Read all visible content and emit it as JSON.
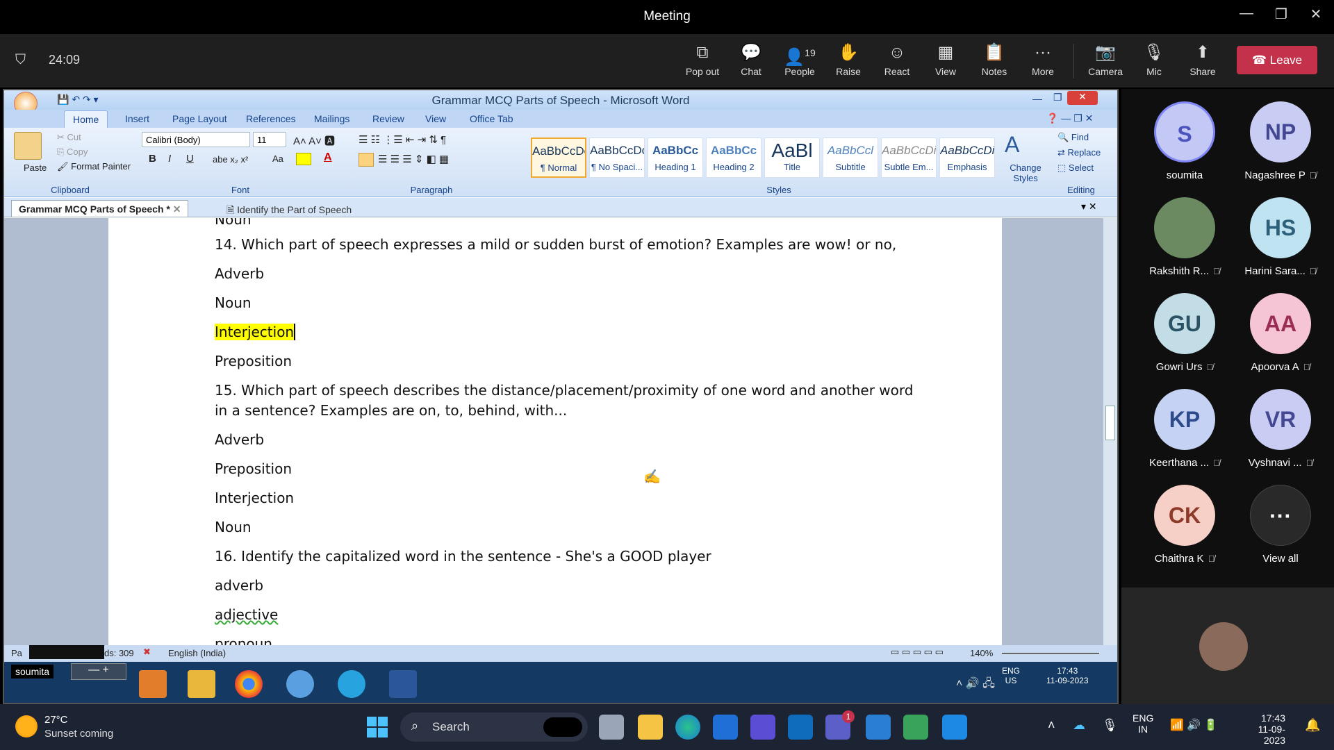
{
  "teams": {
    "window_title": "Meeting",
    "timer": "24:09",
    "toolbar": [
      {
        "label": "Pop out",
        "icon": "pop-out-icon"
      },
      {
        "label": "Chat",
        "icon": "chat-icon"
      },
      {
        "label": "People",
        "icon": "people-icon",
        "count": "19"
      },
      {
        "label": "Raise",
        "icon": "raise-hand-icon"
      },
      {
        "label": "React",
        "icon": "react-icon"
      },
      {
        "label": "View",
        "icon": "view-icon"
      },
      {
        "label": "Notes",
        "icon": "notes-icon"
      },
      {
        "label": "More",
        "icon": "more-icon"
      },
      {
        "label": "Camera",
        "icon": "camera-off-icon"
      },
      {
        "label": "Mic",
        "icon": "mic-off-icon"
      },
      {
        "label": "Share",
        "icon": "share-icon"
      }
    ],
    "leave_label": "Leave",
    "participants": [
      {
        "initials": "S",
        "name": "soumita",
        "bg": "#c3c8f5",
        "fg": "#4b53bc"
      },
      {
        "initials": "NP",
        "name": "Nagashree P",
        "bg": "#c9cdf3",
        "fg": "#444791"
      },
      {
        "initials": "",
        "name": "Rakshith R...",
        "bg": "#6b8a62",
        "fg": "#fff"
      },
      {
        "initials": "HS",
        "name": "Harini Sara...",
        "bg": "#c0e3f2",
        "fg": "#2d5f78"
      },
      {
        "initials": "GU",
        "name": "Gowri Urs",
        "bg": "#c2dde6",
        "fg": "#2c5363"
      },
      {
        "initials": "AA",
        "name": "Apoorva A",
        "bg": "#f5c5d6",
        "fg": "#9a2d54"
      },
      {
        "initials": "KP",
        "name": "Keerthana ...",
        "bg": "#c5d2f3",
        "fg": "#2d4a8b"
      },
      {
        "initials": "VR",
        "name": "Vyshnavi ...",
        "bg": "#c9cdf3",
        "fg": "#444791"
      },
      {
        "initials": "CK",
        "name": "Chaithra K",
        "bg": "#f6cfc7",
        "fg": "#8d3a28"
      },
      {
        "initials": "···",
        "name": "View all",
        "bg": "#292929",
        "fg": "#fff"
      }
    ]
  },
  "word": {
    "title": "Grammar MCQ Parts of Speech - Microsoft Word",
    "tabs": [
      "Home",
      "Insert",
      "Page Layout",
      "References",
      "Mailings",
      "Review",
      "View",
      "Office Tab"
    ],
    "clipboard": {
      "paste": "Paste",
      "cut": "Cut",
      "copy": "Copy",
      "format_painter": "Format Painter",
      "label": "Clipboard"
    },
    "font": {
      "name": "Calibri (Body)",
      "size": "11",
      "label": "Font"
    },
    "paragraph_label": "Paragraph",
    "styles": [
      {
        "sample": "AaBbCcDc",
        "name": "¶ Normal"
      },
      {
        "sample": "AaBbCcDc",
        "name": "¶ No Spaci..."
      },
      {
        "sample": "AaBbCc",
        "name": "Heading 1"
      },
      {
        "sample": "AaBbCc",
        "name": "Heading 2"
      },
      {
        "sample": "AaBl",
        "name": "Title"
      },
      {
        "sample": "AaBbCcl",
        "name": "Subtitle"
      },
      {
        "sample": "AaBbCcDi",
        "name": "Subtle Em..."
      },
      {
        "sample": "AaBbCcDi",
        "name": "Emphasis"
      }
    ],
    "change_styles": "Change Styles",
    "styles_label": "Styles",
    "editing": {
      "find": "Find",
      "replace": "Replace",
      "select": "Select",
      "label": "Editing"
    },
    "doc_tabs": [
      "Grammar MCQ Parts of Speech *",
      "Identify the Part of Speech"
    ],
    "lines": [
      "Noun",
      "14. Which part of speech expresses a mild or sudden burst of emotion? Examples are wow! or no,",
      "Adverb",
      "Noun",
      "Interjection",
      "Preposition",
      "15. Which part of speech describes the distance/placement/proximity of one word and another word",
      "in a sentence? Examples are on, to, behind, with...",
      "Adverb",
      "Preposition",
      "Interjection",
      "Noun",
      "16. Identify the capitalized word in the sentence - She's a GOOD player",
      "adverb",
      "adjective",
      "pronoun"
    ],
    "status": {
      "words": "ds: 309",
      "language": "English (India)",
      "zoom": "140%",
      "page_prefix": "Pa"
    },
    "remote_taskbar": {
      "user": "soumita",
      "lang": "ENG",
      "region": "US",
      "time": "17:43",
      "date": "11-09-2023"
    }
  },
  "taskbar": {
    "weather_temp": "27°C",
    "weather_desc": "Sunset coming",
    "search_placeholder": "Search",
    "lang": "ENG",
    "region": "IN",
    "time": "17:43",
    "date": "11-09-2023",
    "teams_badge": "1"
  }
}
